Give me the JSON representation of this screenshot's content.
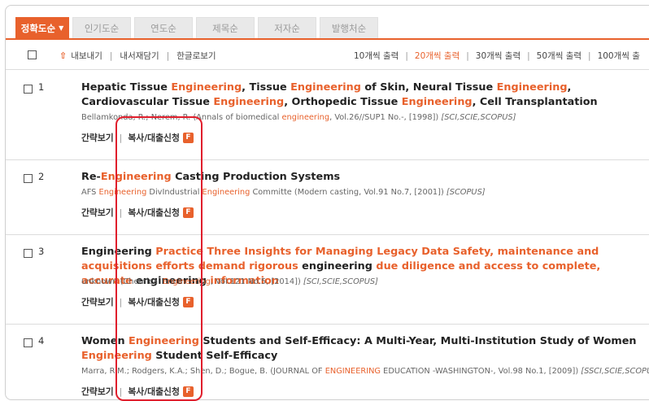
{
  "tabs": [
    {
      "label": "정확도순",
      "caret": "▼",
      "active": true
    },
    {
      "label": "인기도순"
    },
    {
      "label": "연도순"
    },
    {
      "label": "제목순"
    },
    {
      "label": "저자순"
    },
    {
      "label": "발행처순"
    }
  ],
  "toolbar": {
    "export_label": "내보내기",
    "save_label": "내서재담기",
    "korean_view_label": "한글로보기",
    "sep": "|",
    "per_page": [
      "10개씩 출력",
      "20개씩 출력",
      "30개씩 출력",
      "50개씩 출력",
      "100개씩 출"
    ],
    "per_page_selected": "20개씩 출력"
  },
  "results": [
    {
      "num": "1",
      "title_parts": [
        "Hepatic Tissue ",
        "Engineering",
        ", Tissue ",
        "Engineering",
        " of Skin, Neural Tissue ",
        "Engineering",
        ", Cardiovascular Tissue ",
        "Engineering",
        ", Orthopedic Tissue ",
        "Engineering",
        ", Cell Transplantation"
      ],
      "meta_parts": [
        "Bellamkonda, R.; Nerem, R. (Annals of biomedical ",
        "engineering",
        ", Vol.26//SUP1 No.-, [1998]) "
      ],
      "indexes": "[SCI,SCIE,SCOPUS]"
    },
    {
      "num": "2",
      "title_parts": [
        "Re-",
        "Engineering",
        " Casting Production Systems"
      ],
      "meta_parts": [
        "AFS ",
        "Engineering",
        " DivIndustrial ",
        "Engineering",
        " Committe (Modern casting, Vol.91 No.7, [2001]) "
      ],
      "indexes": "[SCOPUS]"
    },
    {
      "num": "3",
      "title_parts": [
        "Engineering",
        " Practice Three Insights for Managing Legacy Data Safety, maintenance and acquisitions efforts demand rigorous ",
        "engineering",
        " due diligence and access to complete, accurate ",
        "engineering",
        " information"
      ],
      "meta_parts": [
        "unknown (Chemical ",
        "Engineering",
        ", Vol.121 No.5, [2014]) "
      ],
      "indexes": "[SCI,SCIE,SCOPUS]"
    },
    {
      "num": "4",
      "title_parts": [
        "Women ",
        "Engineering",
        " Students and Self-Efficacy: A Multi-Year, Multi-Institution Study of Women ",
        "Engineering",
        " Student Self-Efficacy"
      ],
      "meta_parts": [
        "Marra, R.M.; Rodgers, K.A.; Shen, D.; Bogue, B. (JOURNAL OF ",
        "ENGINEERING",
        " EDUCATION -WASHINGTON-, Vol.98 No.1, [2009]) "
      ],
      "indexes": "[SSCI,SCIE,SCOPU"
    }
  ],
  "actions": {
    "summary_label": "간략보기",
    "copy_request_label": "복사/대출신청",
    "badge": "F",
    "sep": "|"
  },
  "colors": {
    "accent": "#e8612c",
    "highlight_box": "#e01e2c"
  }
}
